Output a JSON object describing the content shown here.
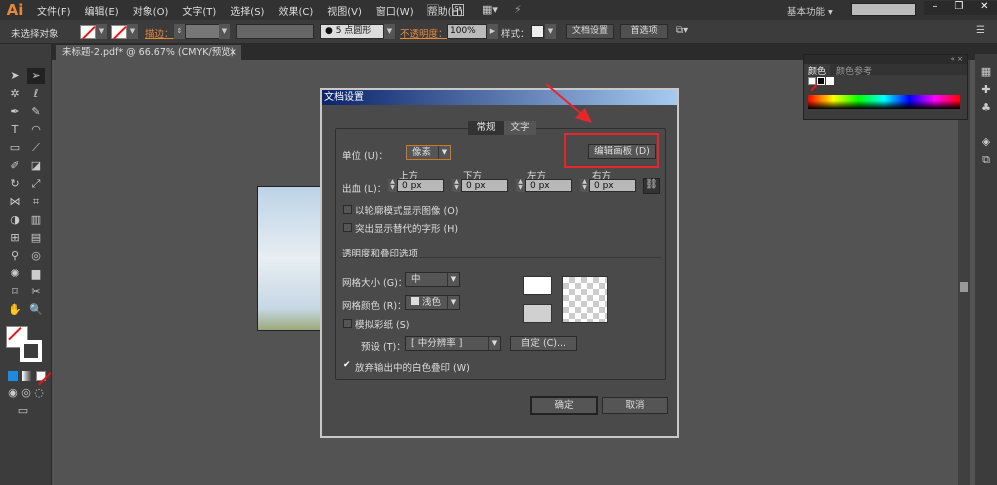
{
  "app": {
    "logo": "Ai"
  },
  "menu": [
    "文件(F)",
    "编辑(E)",
    "对象(O)",
    "文字(T)",
    "选择(S)",
    "效果(C)",
    "视图(V)",
    "窗口(W)",
    "帮助(H)"
  ],
  "topbar": {
    "br": "Br",
    "st": "St",
    "workspace": "基本功能 ▾",
    "search_placeholder": ""
  },
  "control": {
    "selection": "未选择对象",
    "stroke_label": "描边：",
    "brush": "5 点圆形",
    "opacity_label": "不透明度：",
    "opacity": "100%",
    "style_label": "样式：",
    "doc_setup": "文档设置",
    "prefs": "首选项"
  },
  "doc_tab": {
    "title": "未标题-2.pdf* @ 66.67% (CMYK/预览)",
    "close": "×"
  },
  "color_panel": {
    "tabs": [
      "颜色",
      "颜色参考"
    ]
  },
  "dialog": {
    "title": "文档设置",
    "tabs": [
      "常规",
      "文字"
    ],
    "units_label": "单位 (U)：",
    "units": "像素",
    "edit_artboards": "编辑画板 (D)",
    "bleed_label": "出血 (L)：",
    "bleed": [
      {
        "label": "上方",
        "value": "0 px"
      },
      {
        "label": "下方",
        "value": "0 px"
      },
      {
        "label": "左方",
        "value": "0 px"
      },
      {
        "label": "右方",
        "value": "0 px"
      }
    ],
    "cb_outline": {
      "label": "以轮廓模式显示图像 (O)",
      "checked": false
    },
    "cb_glyph": {
      "label": "突出显示替代的字形 (H)",
      "checked": false
    },
    "section": "透明度和叠印选项",
    "grid_size_label": "网格大小 (G)：",
    "grid_size": "中",
    "grid_color_label": "网格颜色 (R)：",
    "grid_color": "浅色",
    "cb_paper": {
      "label": "模拟彩纸 (S)",
      "checked": false
    },
    "preset_label": "预设 (T)：",
    "preset": "[ 中分辨率 ]",
    "custom": "自定 (C)...",
    "cb_discard": {
      "label": "放弃输出中的白色叠印 (W)",
      "checked": true
    },
    "ok": "确定",
    "cancel": "取消"
  },
  "colors": {
    "accent": "#e38a3a",
    "highlight": "#e8262a",
    "title_start": "#0b246a",
    "title_end": "#a6caf0"
  }
}
